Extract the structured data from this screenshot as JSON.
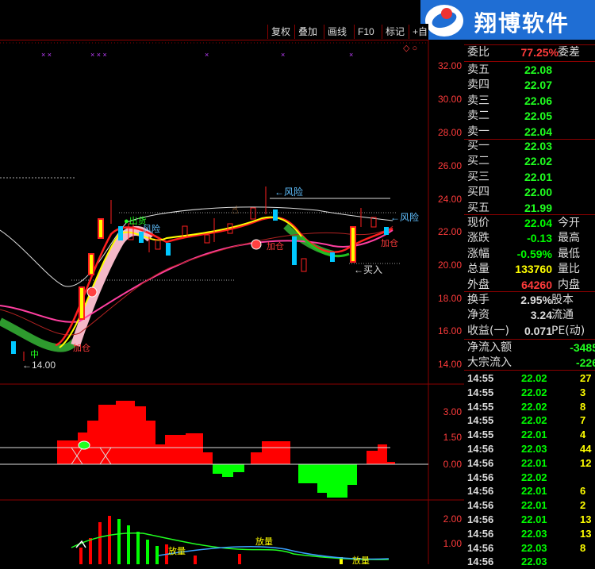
{
  "toolbar": {
    "buttons": [
      "复权",
      "叠加",
      "画线",
      "F10",
      "标记",
      "+自"
    ]
  },
  "logo": {
    "text": "翔博软件"
  },
  "main_axis": [
    "32.00",
    "30.00",
    "28.00",
    "26.00",
    "24.00",
    "22.00",
    "20.00",
    "18.00",
    "16.00",
    "14.00"
  ],
  "macd_axis": [
    "3.00",
    "1.50",
    "0.00"
  ],
  "vol_axis": [
    "2.00",
    "1.00"
  ],
  "annotations": {
    "risk1": "←风险",
    "risk2": "←风险",
    "ship": "●出货",
    "risk_small": "风险",
    "add1": "加仓",
    "add2": "加仓",
    "add3": "加仓",
    "buy": "←买入",
    "low": "←14.00",
    "mid": "中",
    "vol1": "放量",
    "vol2": "放量",
    "vol3": "放量"
  },
  "quote": {
    "weibi_label": "委比",
    "weibi_value": "77.25%",
    "weicha_label": "委差",
    "sell": [
      {
        "label": "卖五",
        "price": "22.08"
      },
      {
        "label": "卖四",
        "price": "22.07"
      },
      {
        "label": "卖三",
        "price": "22.06"
      },
      {
        "label": "卖二",
        "price": "22.05"
      },
      {
        "label": "卖一",
        "price": "22.04"
      }
    ],
    "buy": [
      {
        "label": "买一",
        "price": "22.03"
      },
      {
        "label": "买二",
        "price": "22.02"
      },
      {
        "label": "买三",
        "price": "22.01"
      },
      {
        "label": "买四",
        "price": "22.00"
      },
      {
        "label": "买五",
        "price": "21.99"
      }
    ],
    "stats": [
      {
        "label": "现价",
        "value": "22.04",
        "label2": "今开",
        "color": "#00ff00"
      },
      {
        "label": "涨跌",
        "value": "-0.13",
        "label2": "最高",
        "color": "#00ff00"
      },
      {
        "label": "涨幅",
        "value": "-0.59%",
        "label2": "最低",
        "color": "#00ff00"
      },
      {
        "label": "总量",
        "value": "133760",
        "label2": "量比",
        "color": "#ffff00"
      },
      {
        "label": "外盘",
        "value": "64260",
        "label2": "内盘",
        "color": "#ff3b3b"
      }
    ],
    "stats2": [
      {
        "label": "换手",
        "value": "2.95%",
        "label2": "股本",
        "color": "#dddddd"
      },
      {
        "label": "净资",
        "value": "3.24",
        "label2": "流通",
        "color": "#dddddd"
      },
      {
        "label": "收益(一)",
        "value": "0.071",
        "label2": "PE(动)",
        "color": "#dddddd"
      }
    ],
    "flow": [
      {
        "label": "净流入额",
        "value": "-3485"
      },
      {
        "label": "大宗流入",
        "value": "-226"
      }
    ]
  },
  "ticks": [
    {
      "time": "14:55",
      "price": "22.02",
      "qty": "27",
      "color": "#00ff00"
    },
    {
      "time": "14:55",
      "price": "22.02",
      "qty": "3",
      "color": "#00ff00"
    },
    {
      "time": "14:55",
      "price": "22.02",
      "qty": "8",
      "color": "#00ff00"
    },
    {
      "time": "14:55",
      "price": "22.02",
      "qty": "7",
      "color": "#00ff00"
    },
    {
      "time": "14:55",
      "price": "22.01",
      "qty": "4",
      "color": "#00ff00"
    },
    {
      "time": "14:56",
      "price": "22.03",
      "qty": "44",
      "color": "#00ff00"
    },
    {
      "time": "14:56",
      "price": "22.01",
      "qty": "12",
      "color": "#00ff00"
    },
    {
      "time": "14:56",
      "price": "22.02",
      "qty": "",
      "color": "#00ff00"
    },
    {
      "time": "14:56",
      "price": "22.01",
      "qty": "6",
      "color": "#00ff00"
    },
    {
      "time": "14:56",
      "price": "22.01",
      "qty": "2",
      "color": "#00ff00"
    },
    {
      "time": "14:56",
      "price": "22.01",
      "qty": "13",
      "color": "#00ff00"
    },
    {
      "time": "14:56",
      "price": "22.03",
      "qty": "13",
      "color": "#00ff00"
    },
    {
      "time": "14:56",
      "price": "22.03",
      "qty": "8",
      "color": "#00ff00"
    },
    {
      "time": "14:56",
      "price": "22.03",
      "qty": "",
      "color": "#00ff00"
    }
  ]
}
